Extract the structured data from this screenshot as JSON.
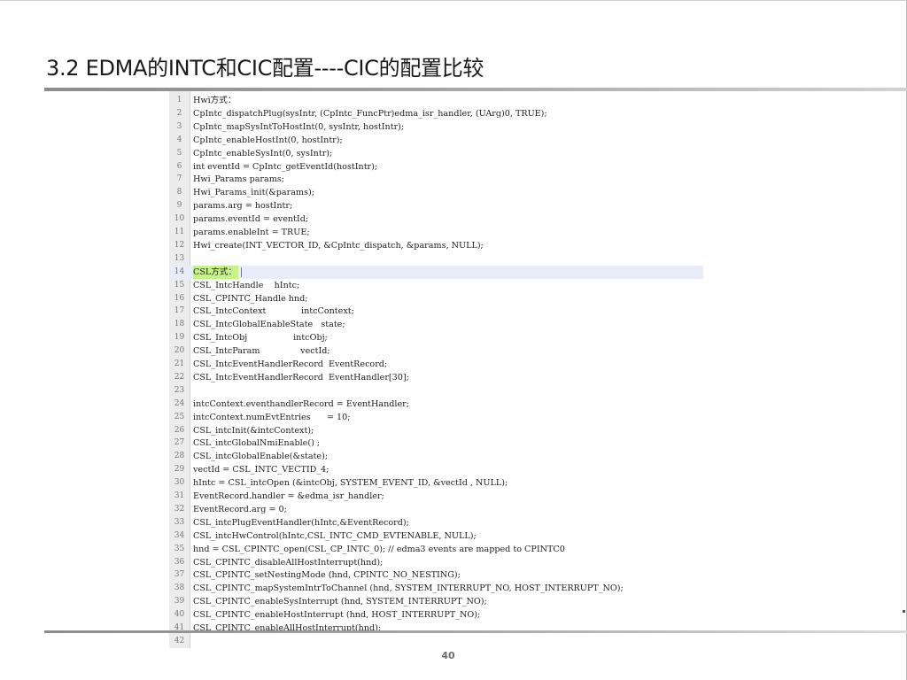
{
  "slide": {
    "title": "3.2 EDMA的INTC和CIC配置----CIC的配置比较",
    "page_number": "40"
  },
  "code": {
    "highlighted_line": 14,
    "lines": [
      {
        "num": "1",
        "text": "Hwi方式："
      },
      {
        "num": "2",
        "text": "CpIntc_dispatchPlug(sysIntr, (CpIntc_FuncPtr)edma_isr_handler, (UArg)0, TRUE);"
      },
      {
        "num": "3",
        "text": "CpIntc_mapSysIntToHostInt(0, sysIntr, hostIntr);"
      },
      {
        "num": "4",
        "text": "CpIntc_enableHostInt(0, hostIntr);"
      },
      {
        "num": "5",
        "text": "CpIntc_enableSysInt(0, sysIntr);"
      },
      {
        "num": "6",
        "text": "int eventId = CpIntc_getEventId(hostIntr);"
      },
      {
        "num": "7",
        "text": "Hwi_Params params;"
      },
      {
        "num": "8",
        "text": "Hwi_Params_init(&params);"
      },
      {
        "num": "9",
        "text": "params.arg = hostIntr;"
      },
      {
        "num": "10",
        "text": "params.eventId = eventId;"
      },
      {
        "num": "11",
        "text": "params.enableInt = TRUE;"
      },
      {
        "num": "12",
        "text": "Hwi_create(INT_VECTOR_ID, &CpIntc_dispatch, &params, NULL);"
      },
      {
        "num": "13",
        "text": ""
      },
      {
        "num": "14",
        "text": "CSL方式："
      },
      {
        "num": "15",
        "text": "CSL_IntcHandle    hIntc;"
      },
      {
        "num": "16",
        "text": "CSL_CPINTC_Handle hnd;"
      },
      {
        "num": "17",
        "text": "CSL_IntcContext             intcContext;"
      },
      {
        "num": "18",
        "text": "CSL_IntcGlobalEnableState   state;"
      },
      {
        "num": "19",
        "text": "CSL_IntcObj                 intcObj;"
      },
      {
        "num": "20",
        "text": "CSL_IntcParam               vectId;"
      },
      {
        "num": "21",
        "text": "CSL_IntcEventHandlerRecord  EventRecord;"
      },
      {
        "num": "22",
        "text": "CSL_IntcEventHandlerRecord  EventHandler[30];"
      },
      {
        "num": "23",
        "text": ""
      },
      {
        "num": "24",
        "text": "intcContext.eventhandlerRecord = EventHandler;"
      },
      {
        "num": "25",
        "text": "intcContext.numEvtEntries      = 10;"
      },
      {
        "num": "26",
        "text": "CSL_intcInit(&intcContext);"
      },
      {
        "num": "27",
        "text": "CSL_intcGlobalNmiEnable() ;"
      },
      {
        "num": "28",
        "text": "CSL_intcGlobalEnable(&state);"
      },
      {
        "num": "29",
        "text": "vectId = CSL_INTC_VECTID_4;"
      },
      {
        "num": "30",
        "text": "hIntc = CSL_intcOpen (&intcObj, SYSTEM_EVENT_ID, &vectId , NULL);"
      },
      {
        "num": "31",
        "text": "EventRecord.handler = &edma_isr_handler;"
      },
      {
        "num": "32",
        "text": "EventRecord.arg = 0;"
      },
      {
        "num": "33",
        "text": "CSL_intcPlugEventHandler(hIntc,&EventRecord);"
      },
      {
        "num": "34",
        "text": "CSL_intcHwControl(hIntc,CSL_INTC_CMD_EVTENABLE, NULL);"
      },
      {
        "num": "35",
        "text": "hnd = CSL_CPINTC_open(CSL_CP_INTC_0); // edma3 events are mapped to CPINTC0"
      },
      {
        "num": "36",
        "text": "CSL_CPINTC_disableAllHostInterrupt(hnd);"
      },
      {
        "num": "37",
        "text": "CSL_CPINTC_setNestingMode (hnd, CPINTC_NO_NESTING);"
      },
      {
        "num": "38",
        "text": "CSL_CPINTC_mapSystemIntrToChannel (hnd, SYSTEM_INTERRUPT_NO, HOST_INTERRUPT_NO);"
      },
      {
        "num": "39",
        "text": "CSL_CPINTC_enableSysInterrupt (hnd, SYSTEM_INTERRUPT_NO);"
      },
      {
        "num": "40",
        "text": "CSL_CPINTC_enableHostInterrupt (hnd, HOST_INTERRUPT_NO);"
      },
      {
        "num": "41",
        "text": "CSL_CPINTC_enableAllHostInterrupt(hnd);"
      },
      {
        "num": "42",
        "text": ""
      }
    ]
  }
}
